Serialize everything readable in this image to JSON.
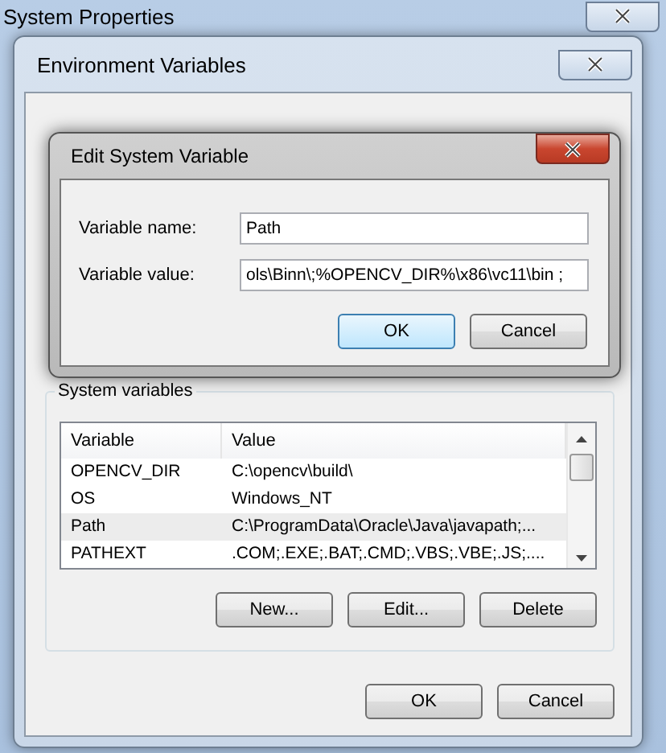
{
  "window": {
    "title": "System Properties"
  },
  "env_dialog": {
    "title": "Environment Variables",
    "system_variables": {
      "label": "System variables",
      "columns": [
        "Variable",
        "Value"
      ],
      "rows": [
        {
          "variable": "OPENCV_DIR",
          "value": "C:\\opencv\\build\\",
          "selected": false
        },
        {
          "variable": "OS",
          "value": "Windows_NT",
          "selected": false
        },
        {
          "variable": "Path",
          "value": "C:\\ProgramData\\Oracle\\Java\\javapath;...",
          "selected": true
        },
        {
          "variable": "PATHEXT",
          "value": ".COM;.EXE;.BAT;.CMD;.VBS;.VBE;.JS;....",
          "selected": false
        }
      ],
      "buttons": [
        "New...",
        "Edit...",
        "Delete"
      ]
    },
    "buttons": [
      "OK",
      "Cancel"
    ]
  },
  "edit_dialog": {
    "title": "Edit System Variable",
    "fields": [
      {
        "label": "Variable name:",
        "value": "Path"
      },
      {
        "label": "Variable value:",
        "value": "ols\\Binn\\;%OPENCV_DIR%\\x86\\vc11\\bin ;"
      }
    ],
    "buttons": [
      {
        "label": "OK",
        "default": true
      },
      {
        "label": "Cancel",
        "default": false
      }
    ]
  }
}
